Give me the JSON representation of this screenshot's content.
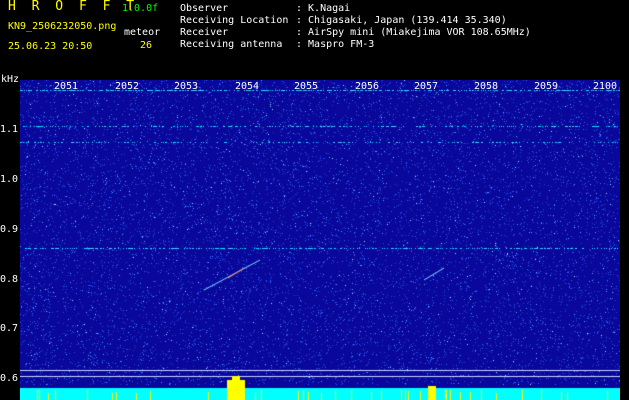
{
  "header": {
    "app_title": "H R O F F T",
    "version": "1.0.0f",
    "filename": "KN9_2506232050.png",
    "datetime": "25.06.23 20:50",
    "meteor_label": "meteor",
    "meteor_count": "26",
    "info_labels": [
      "Observer",
      "Receiving Location",
      "Receiver",
      "Receiving antenna"
    ],
    "info_values": [
      ": K.Nagai",
      ": Chigasaki, Japan (139.414 35.340)",
      ": AirSpy mini (Miakejima VOR 108.65MHz)",
      ": Maspro FM-3"
    ]
  },
  "plot": {
    "y_unit": "kHz",
    "y_ticks": [
      "1.1",
      "1.0",
      "0.9",
      "0.8",
      "0.7",
      "0.6"
    ],
    "x_ticks": [
      "2051",
      "2052",
      "2053",
      "2054",
      "2055",
      "2056",
      "2057",
      "2058",
      "2059",
      "2100"
    ],
    "colors": {
      "background": "#09089a",
      "noise": "#2f5bff",
      "signal": "#00e5ff",
      "bottom_band": "#00ffff",
      "bursts": "#ffff00"
    }
  }
}
